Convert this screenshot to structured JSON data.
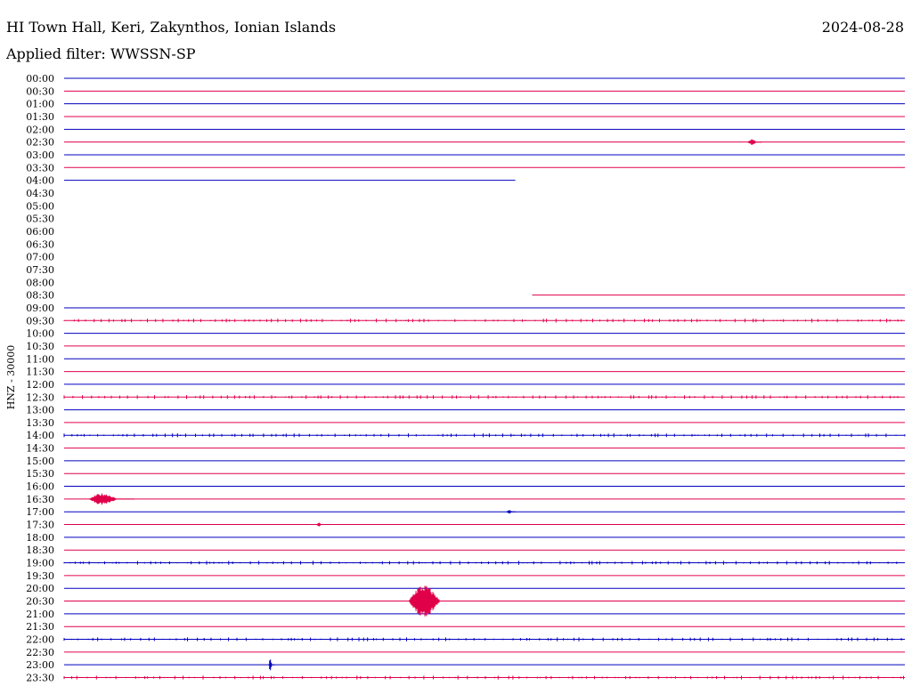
{
  "header": {
    "station": "HI Town Hall, Keri, Zakynthos, Ionian Islands",
    "date": "2024-08-28",
    "filter": "Applied filter: WWSSN-SP"
  },
  "chart_data": {
    "type": "line",
    "title": "HI Town Hall, Keri, Zakynthos, Ionian Islands",
    "subtitle": "Applied filter: WWSSN-SP",
    "date": "2024-08-28",
    "ylabel": "HNZ - 30000",
    "colors": [
      "#0000c0",
      "#e0004a"
    ],
    "tick_labels": [
      "00:00",
      "00:30",
      "01:00",
      "01:30",
      "02:00",
      "02:30",
      "03:00",
      "03:30",
      "04:00",
      "04:30",
      "05:00",
      "05:30",
      "06:00",
      "06:30",
      "07:00",
      "07:30",
      "08:00",
      "08:30",
      "09:00",
      "09:30",
      "10:00",
      "10:30",
      "11:00",
      "11:30",
      "12:00",
      "12:30",
      "13:00",
      "13:30",
      "14:00",
      "14:30",
      "15:00",
      "15:30",
      "16:00",
      "16:30",
      "17:00",
      "17:30",
      "18:00",
      "18:30",
      "19:00",
      "19:30",
      "20:00",
      "20:30",
      "21:00",
      "21:30",
      "22:00",
      "22:30",
      "23:00",
      "23:30"
    ],
    "xlim": [
      0,
      30
    ],
    "coverage": [
      {
        "row": "04:00",
        "from": 0,
        "to": 16.1
      },
      {
        "row": "04:30",
        "from": 0,
        "to": 0
      },
      {
        "row": "05:00",
        "from": 0,
        "to": 0
      },
      {
        "row": "05:30",
        "from": 0,
        "to": 0
      },
      {
        "row": "06:00",
        "from": 0,
        "to": 0
      },
      {
        "row": "06:30",
        "from": 0,
        "to": 0
      },
      {
        "row": "07:00",
        "from": 0,
        "to": 0
      },
      {
        "row": "07:30",
        "from": 0,
        "to": 0
      },
      {
        "row": "08:00",
        "from": 0,
        "to": 0
      },
      {
        "row": "08:30",
        "from": 16.7,
        "to": 30
      }
    ],
    "noisy_rows": [
      "09:30",
      "12:30",
      "14:00",
      "19:00",
      "22:00",
      "23:30"
    ],
    "events": [
      {
        "row": "02:30",
        "minute": 24.4,
        "duration": 0.5,
        "amplitude": 0.3
      },
      {
        "row": "16:30",
        "minute": 0.9,
        "duration": 1.6,
        "amplitude": 0.6
      },
      {
        "row": "17:00",
        "minute": 15.8,
        "duration": 0.3,
        "amplitude": 0.2
      },
      {
        "row": "17:30",
        "minute": 9.0,
        "duration": 0.3,
        "amplitude": 0.2
      },
      {
        "row": "20:30",
        "minute": 12.3,
        "duration": 1.8,
        "amplitude": 1.7
      },
      {
        "row": "23:00",
        "minute": 7.3,
        "duration": 0.2,
        "amplitude": 0.6
      }
    ]
  }
}
